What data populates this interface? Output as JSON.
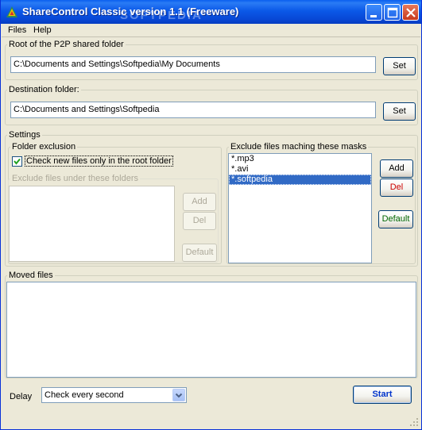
{
  "window": {
    "title": "ShareControl Classic version 1.1 (Freeware)",
    "watermark": "SOFTPEDIA"
  },
  "menu": [
    {
      "label": "Files"
    },
    {
      "label": "Help"
    }
  ],
  "root_folder": {
    "legend": "Root of the P2P shared folder",
    "value": "C:\\Documents and Settings\\Softpedia\\My Documents",
    "set_label": "Set"
  },
  "destination": {
    "legend": "Destination folder:",
    "value": "C:\\Documents and Settings\\Softpedia",
    "set_label": "Set"
  },
  "settings": {
    "legend": "Settings",
    "folder_exclusion": {
      "legend": "Folder exclusion",
      "checkbox_label": "Check new files only in the root folder",
      "checked": true,
      "exclude_under": {
        "legend": "Exclude files under these folders",
        "add_label": "Add",
        "del_label": "Del",
        "default_label": "Default"
      }
    },
    "masks": {
      "legend": "Exclude files maching these masks",
      "items": [
        "*.mp3",
        "*.avi",
        "*.softpedia"
      ],
      "selected_index": 2,
      "add_label": "Add",
      "del_label": "Del",
      "default_label": "Default"
    }
  },
  "moved_files": {
    "legend": "Moved files"
  },
  "footer": {
    "delay_label": "Delay",
    "delay_value": "Check every second",
    "start_label": "Start"
  },
  "colors": {
    "titlebar": "#0B59E8",
    "selection": "#316AC5",
    "del_text": "#CC0000",
    "default_text": "#006600",
    "start_text": "#0033CC"
  }
}
